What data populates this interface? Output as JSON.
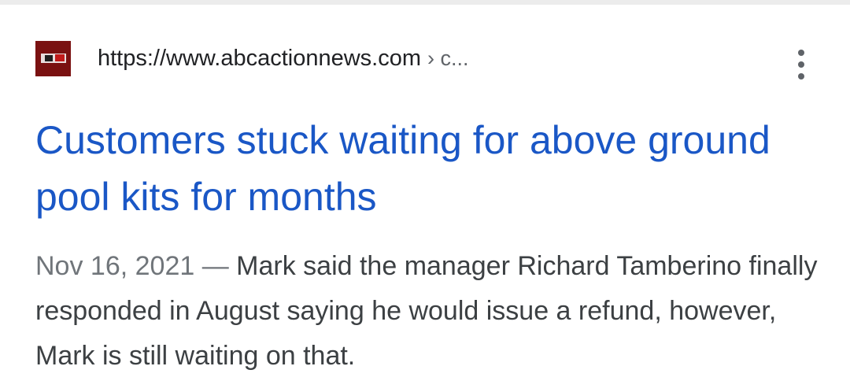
{
  "result": {
    "source": {
      "favicon_icon": "abc-action-news-logo-icon",
      "url": "https://www.abcactionnews.com",
      "breadcrumb": "› c..."
    },
    "more_options_icon": "more-vert-icon",
    "title": "Customers stuck waiting for above ground pool kits for months",
    "snippet": {
      "date": "Nov 16, 2021",
      "separator": " — ",
      "text": "Mark said the manager Richard Tamberino finally responded in August saying he would issue a refund, however, Mark is still waiting on that."
    }
  },
  "colors": {
    "title_link": "#1a57c6",
    "snippet_text": "#3c4043",
    "date_text": "#70757a",
    "favicon_bg": "#7a1111"
  }
}
